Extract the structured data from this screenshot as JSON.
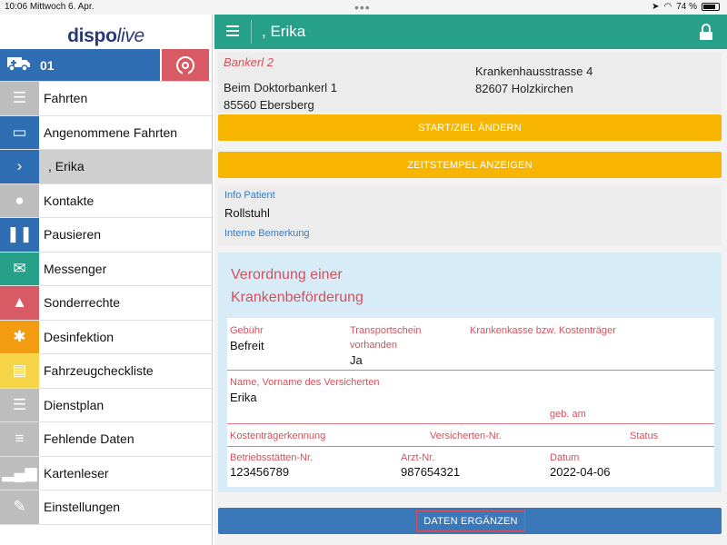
{
  "status": {
    "time": "10:06",
    "date": "Mittwoch 6. Apr.",
    "battery": "74 %"
  },
  "logo": {
    "disp": "disp",
    "o": "o",
    "live": "live"
  },
  "vehicle": {
    "label": "01"
  },
  "menu": [
    {
      "label": "Fahrten",
      "icon": "list-check-icon",
      "color": "#bdbdbd",
      "glyph": "☰"
    },
    {
      "label": "Angenommene Fahrten",
      "icon": "id-card-icon",
      "color": "#2f6eb3",
      "glyph": "▭"
    },
    {
      "label": ", Erika",
      "icon": "chevron-right-icon",
      "color": "#2f6eb3",
      "glyph": "›"
    },
    {
      "label": "Kontakte",
      "icon": "users-icon",
      "color": "#bdbdbd",
      "glyph": "●"
    },
    {
      "label": "Pausieren",
      "icon": "pause-icon",
      "color": "#2f6eb3",
      "glyph": "❚❚"
    },
    {
      "label": "Messenger",
      "icon": "envelope-icon",
      "color": "#27a08a",
      "glyph": "✉"
    },
    {
      "label": "Sonderrechte",
      "icon": "bell-icon",
      "color": "#d85a64",
      "glyph": "▲"
    },
    {
      "label": "Desinfektion",
      "icon": "bug-icon",
      "color": "#f39c12",
      "glyph": "✱"
    },
    {
      "label": "Fahrzeugcheckliste",
      "icon": "clipboard-icon",
      "color": "#f5d547",
      "glyph": "▤"
    },
    {
      "label": "Dienstplan",
      "icon": "list-icon",
      "color": "#bdbdbd",
      "glyph": "☰"
    },
    {
      "label": "Fehlende Daten",
      "icon": "database-icon",
      "color": "#bdbdbd",
      "glyph": "≡"
    },
    {
      "label": "Kartenleser",
      "icon": "signal-bars-icon",
      "color": "#bdbdbd",
      "glyph": "▂▄▆"
    },
    {
      "label": "Einstellungen",
      "icon": "wrench-icon",
      "color": "#bdbdbd",
      "glyph": "✎"
    }
  ],
  "header": {
    "title": ", Erika"
  },
  "address": {
    "name": "Bankerl 2",
    "line1": "Beim Doktorbankerl 1",
    "line2": "85560 Ebersberg",
    "right1": "Krankenhausstrasse 4",
    "right2": "82607 Holzkirchen"
  },
  "buttons": {
    "start_ziel": "START/ZIEL ÄNDERN",
    "zeitstempel": "ZEITSTEMPEL ANZEIGEN",
    "daten_ergaenzen": "DATEN ERGÄNZEN"
  },
  "info": {
    "patient_label": "Info Patient",
    "patient_value": "Rollstuhl",
    "remark_label": "Interne Bemerkung"
  },
  "prescription": {
    "title": "Verordnung einer Krankenbeförderung",
    "gebuehr_label": "Gebühr",
    "gebuehr_value": "Befreit",
    "transport_label": "Transportschein vorhanden",
    "transport_value": "Ja",
    "kasse_label": "Krankenkasse bzw. Kostenträger",
    "name_label": "Name, Vorname des Versicherten",
    "name_value": "Erika",
    "geb_label": "geb. am",
    "kostentraeger_label": "Kostenträgerkennung",
    "versicherten_label": "Versicherten-Nr.",
    "status_label": "Status",
    "betrieb_label": "Betriebsstätten-Nr.",
    "betrieb_value": "123456789",
    "arzt_label": "Arzt-Nr.",
    "arzt_value": "987654321",
    "datum_label": "Datum",
    "datum_value": "2022-04-06"
  }
}
